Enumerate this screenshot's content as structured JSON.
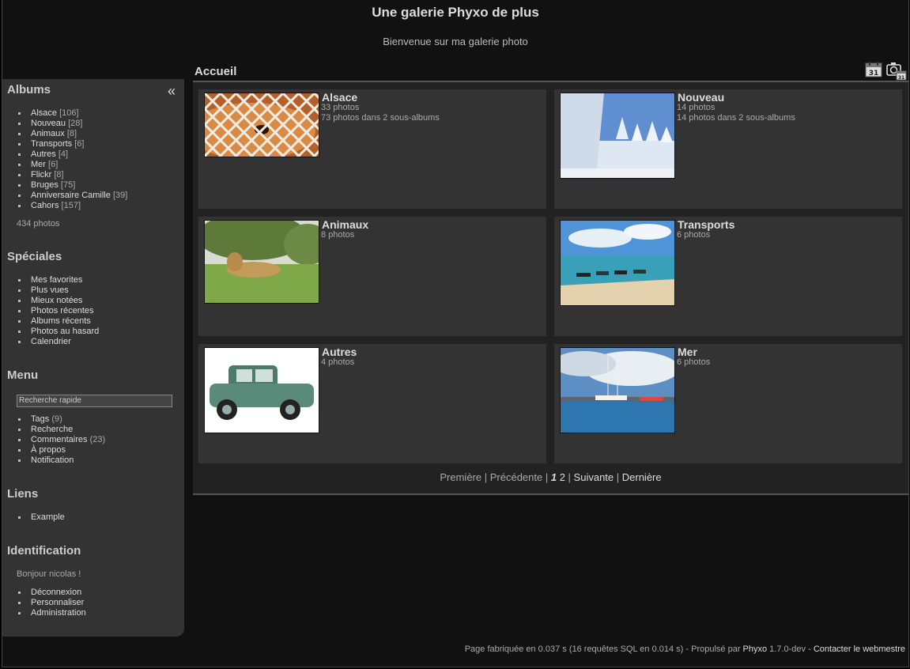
{
  "header": {
    "title": "Une galerie Phyxo de plus",
    "subtitle": "Bienvenue sur ma galerie photo"
  },
  "menubar": {
    "collapse_icon": "double-chevron-left-icon",
    "albums": {
      "title": "Albums",
      "items": [
        {
          "label": "Alsace",
          "count": "[106]"
        },
        {
          "label": "Nouveau",
          "count": "[28]"
        },
        {
          "label": "Animaux",
          "count": "[8]"
        },
        {
          "label": "Transports",
          "count": "[6]"
        },
        {
          "label": "Autres",
          "count": "[4]"
        },
        {
          "label": "Mer",
          "count": "[6]"
        },
        {
          "label": "Flickr",
          "count": "[8]"
        },
        {
          "label": "Bruges",
          "count": "[75]"
        },
        {
          "label": "Anniversaire Camille",
          "count": "[39]"
        },
        {
          "label": "Cahors",
          "count": "[157]"
        }
      ],
      "total": "434 photos"
    },
    "specials": {
      "title": "Spéciales",
      "items": [
        "Mes favorites",
        "Plus vues",
        "Mieux notées",
        "Photos récentes",
        "Albums récents",
        "Photos au hasard",
        "Calendrier"
      ]
    },
    "menu": {
      "title": "Menu",
      "search_placeholder": "Recherche rapide",
      "items": [
        {
          "label": "Tags",
          "count": "(9)"
        },
        {
          "label": "Recherche",
          "count": ""
        },
        {
          "label": "Commentaires",
          "count": "(23)"
        },
        {
          "label": "À propos",
          "count": ""
        },
        {
          "label": "Notification",
          "count": ""
        }
      ]
    },
    "links": {
      "title": "Liens",
      "items": [
        "Example"
      ]
    },
    "identification": {
      "title": "Identification",
      "greeting": "Bonjour nicolas !",
      "items": [
        "Déconnexion",
        "Personnaliser",
        "Administration"
      ]
    }
  },
  "content": {
    "breadcrumb": "Accueil",
    "tools": [
      "calendar-icon",
      "camera-calendar-icon"
    ],
    "albums": [
      {
        "title": "Alsace",
        "lines": [
          "33 photos",
          "73 photos dans 2 sous-albums"
        ],
        "thumb": "tiger-behind-net"
      },
      {
        "title": "Nouveau",
        "lines": [
          "14 photos",
          "14 photos dans 2 sous-albums"
        ],
        "thumb": "snowy-trees"
      },
      {
        "title": "Animaux",
        "lines": [
          "8 photos"
        ],
        "thumb": "lioness-on-grass"
      },
      {
        "title": "Transports",
        "lines": [
          "6 photos"
        ],
        "thumb": "boats-on-beach"
      },
      {
        "title": "Autres",
        "lines": [
          "4 photos"
        ],
        "thumb": "vintage-green-car"
      },
      {
        "title": "Mer",
        "lines": [
          "6 photos"
        ],
        "thumb": "harbor-marina"
      }
    ],
    "pager": {
      "first": "Première",
      "prev": "Précédente",
      "current": "1",
      "page2": "2",
      "next": "Suivante",
      "last": "Dernière",
      "sep": " | "
    }
  },
  "footer": {
    "text1": "Page fabriquée en 0.037 s (16 requêtes SQL en 0.014 s) - Propulsé par ",
    "engine": "Phyxo",
    "text2": " 1.7.0-dev - ",
    "contact": "Contacter le webmestre"
  }
}
